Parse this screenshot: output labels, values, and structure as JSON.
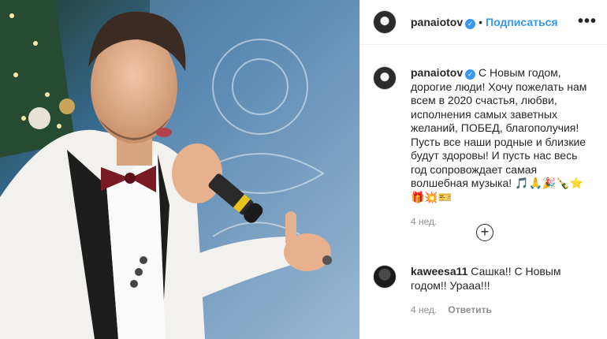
{
  "header": {
    "username": "panaiotov",
    "separator": "•",
    "follow_label": "Подписаться",
    "more_label": "•••",
    "verified_glyph": "✓"
  },
  "post": {
    "username": "panaiotov",
    "caption": "С Новым годом, дорогие люди! Хочу пожелать нам всем в 2020 счастья, любви, исполнения самых заветных желаний, ПОБЕД, благополучия! Пусть все наши родные и близкие будут здоровы! И пусть нас весь год сопровождает самая волшебная музыка! 🎵🙏🎉🍾⭐🎁💥🎫",
    "time": "4 нед."
  },
  "load_more": {
    "icon": "plus-circle-icon",
    "glyph": "+"
  },
  "comment": {
    "username": "kaweesa11",
    "text": "Сашка!! С Новым годом!! Ураaa!!!",
    "time": "4 нед.",
    "reply_label": "Ответить"
  },
  "colors": {
    "accent": "#3897f0",
    "text": "#262626",
    "muted": "#8e8e8e",
    "border": "#efefef"
  }
}
